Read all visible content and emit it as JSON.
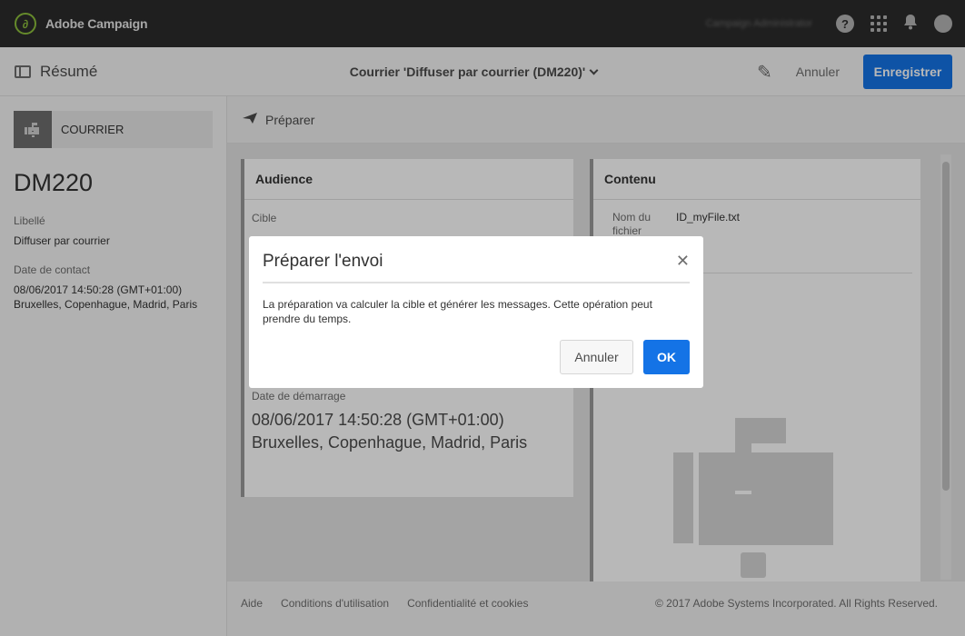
{
  "topbar": {
    "app_name": "Adobe Campaign",
    "user_name": "Campaign Administrator",
    "help_glyph": "?"
  },
  "header": {
    "summary_label": "Résumé",
    "title": "Courrier 'Diffuser par courrier (DM220)'",
    "cancel_label": "Annuler",
    "save_label": "Enregistrer"
  },
  "left_panel": {
    "type_label": "COURRIER",
    "code": "DM220",
    "label_title": "Libellé",
    "label_value": "Diffuser par courrier",
    "contact_date_title": "Date de contact",
    "contact_date_value": "08/06/2017 14:50:28 (GMT+01:00)",
    "contact_date_zone": "Bruxelles, Copenhague, Madrid, Paris"
  },
  "action_bar": {
    "prepare_label": "Préparer"
  },
  "audience": {
    "title": "Audience",
    "target_label": "Cible",
    "start_date_label": "Date de démarrage",
    "start_date_value": "08/06/2017 14:50:28 (GMT+01:00) Bruxelles, Copenhague, Madrid, Paris"
  },
  "contenu": {
    "title": "Contenu",
    "file_name_label": "Nom du fichier",
    "file_name_value": "ID_myFile.txt"
  },
  "footer": {
    "help": "Aide",
    "terms": "Conditions d'utilisation",
    "privacy": "Confidentialité et cookies",
    "copyright": "© 2017 Adobe Systems Incorporated. All Rights Reserved."
  },
  "modal": {
    "title": "Préparer l'envoi",
    "message": "La préparation va calculer la cible et générer les messages. Cette opération peut prendre du temps.",
    "cancel_label": "Annuler",
    "ok_label": "OK"
  },
  "colors": {
    "accent": "#1473e6",
    "topbar": "#2c2c2c"
  }
}
